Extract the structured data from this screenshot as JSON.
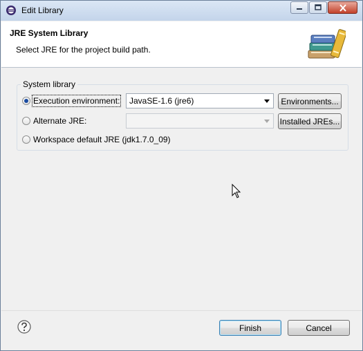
{
  "window": {
    "title": "Edit Library",
    "controls": {
      "minimize": "minimize-icon",
      "maximize": "maximize-icon",
      "close": "close-icon"
    }
  },
  "header": {
    "title": "JRE System Library",
    "subtitle": "Select JRE for the project build path."
  },
  "system_library": {
    "group_label": "System library",
    "options": [
      {
        "label": "Execution environment:",
        "selected": true
      },
      {
        "label": "Alternate JRE:",
        "selected": false
      },
      {
        "label": "Workspace default JRE (jdk1.7.0_09)",
        "selected": false
      }
    ],
    "execution_env_value": "JavaSE-1.6 (jre6)",
    "alternate_jre_value": "",
    "environments_button": "Environments...",
    "installed_jres_button": "Installed JREs..."
  },
  "footer": {
    "help_icon": "help-icon",
    "finish": "Finish",
    "cancel": "Cancel"
  },
  "colors": {
    "titlebar": "#c3d4ea",
    "dialog_bg": "#f0f0f0",
    "radio_dot": "#1a4ba0",
    "close_button": "#c2412a"
  }
}
